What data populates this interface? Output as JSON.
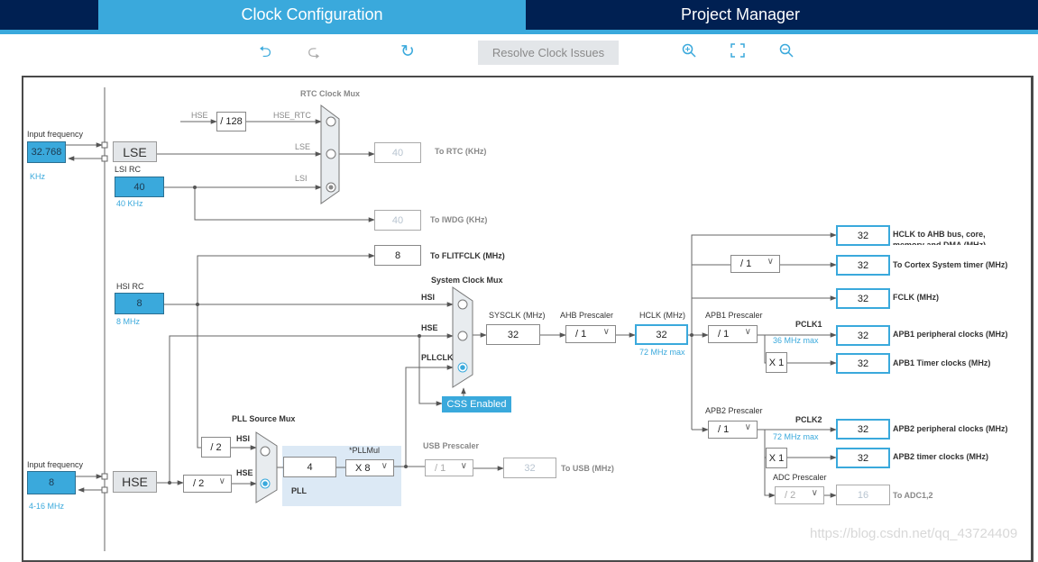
{
  "header": {
    "tabs": [
      {
        "label": "Clock Configuration",
        "active": true
      },
      {
        "label": "Project Manager",
        "active": false
      }
    ]
  },
  "toolbar": {
    "undo": "undo-icon",
    "redo": "redo-icon",
    "reset": "refresh-icon",
    "resolve_label": "Resolve Clock Issues",
    "zoom_in": "zoom-in-icon",
    "fit": "fit-icon",
    "zoom_out": "zoom-out-icon"
  },
  "lse_input": {
    "label": "Input frequency",
    "value": "32.768",
    "unit": "KHz",
    "block": "LSE"
  },
  "lsi": {
    "label": "LSI RC",
    "value": "40",
    "unit": "40 KHz"
  },
  "rtc_mux": {
    "title": "RTC Clock Mux",
    "hse": "HSE",
    "div": "/ 128",
    "hse_rtc": "HSE_RTC",
    "lse": "LSE",
    "lsi": "LSI",
    "selected": "LSI"
  },
  "to_rtc": {
    "value": "40",
    "label": "To RTC (KHz)"
  },
  "to_iwdg": {
    "value": "40",
    "label": "To IWDG (KHz)"
  },
  "to_flit": {
    "value": "8",
    "label": "To FLITFCLK (MHz)"
  },
  "hsi": {
    "label": "HSI RC",
    "value": "8",
    "unit": "8 MHz"
  },
  "sys_mux": {
    "title": "System Clock Mux",
    "hsi": "HSI",
    "hse": "HSE",
    "pllclk": "PLLCLK",
    "selected": "PLLCLK"
  },
  "css": "CSS Enabled",
  "sysclk": {
    "label": "SYSCLK (MHz)",
    "value": "32"
  },
  "ahb": {
    "label": "AHB Prescaler",
    "value": "/ 1"
  },
  "hclk": {
    "label": "HCLK (MHz)",
    "value": "32",
    "max": "72 MHz max"
  },
  "apb1": {
    "label": "APB1 Prescaler",
    "value": "/ 1",
    "pclk": "PCLK1",
    "max": "36 MHz max",
    "timer_mul": "X 1"
  },
  "apb2": {
    "label": "APB2 Prescaler",
    "value": "/ 1",
    "pclk": "PCLK2",
    "max": "72 MHz max",
    "timer_mul": "X 1"
  },
  "adc": {
    "label": "ADC Prescaler",
    "value": "/ 2"
  },
  "cortex_div": "/ 1",
  "outputs": [
    {
      "value": "32",
      "label": "HCLK to AHB bus, core, memory and DMA (MHz)"
    },
    {
      "value": "32",
      "label": "To Cortex System timer (MHz)"
    },
    {
      "value": "32",
      "label": "FCLK (MHz)"
    },
    {
      "value": "32",
      "label": "APB1 peripheral clocks (MHz)"
    },
    {
      "value": "32",
      "label": "APB1 Timer clocks (MHz)"
    },
    {
      "value": "32",
      "label": "APB2 peripheral clocks (MHz)"
    },
    {
      "value": "32",
      "label": "APB2 timer clocks (MHz)"
    },
    {
      "value": "16",
      "label": "To ADC1,2"
    }
  ],
  "hse_input": {
    "label": "Input frequency",
    "value": "8",
    "unit": "4-16 MHz",
    "block": "HSE"
  },
  "hse_prediv": "/ 2",
  "hsi_div": "/ 2",
  "pll_mux": {
    "title": "PLL Source Mux",
    "hsi": "HSI",
    "hse": "HSE",
    "selected": "HSE"
  },
  "pll": {
    "label": "PLL",
    "mul_label": "*PLLMul",
    "input": "4",
    "mul": "X 8"
  },
  "usb": {
    "label": "USB Prescaler",
    "value": "/ 1",
    "out": "32",
    "out_label": "To USB (MHz)"
  },
  "watermark": "https://blog.csdn.net/qq_43724409",
  "colors": {
    "accent": "#3aa9dc",
    "header": "#002052",
    "pll_bg": "#dce9f5"
  }
}
